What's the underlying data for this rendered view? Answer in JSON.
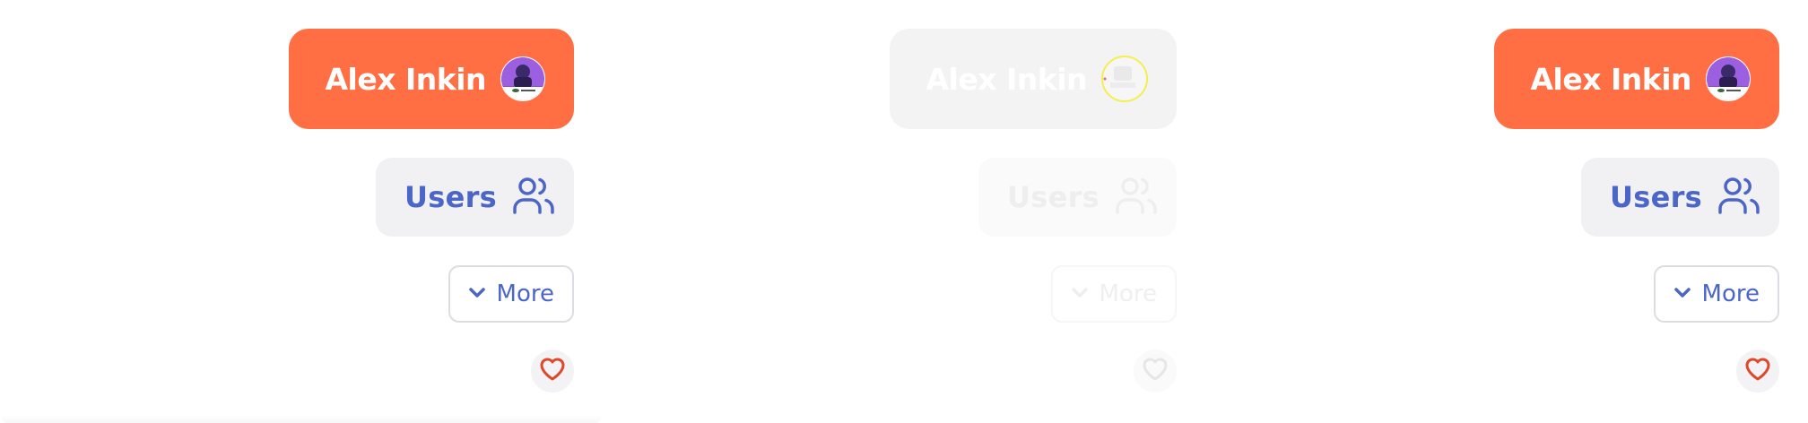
{
  "panels": [
    {
      "state": "normal",
      "user_button": {
        "name": "Alex Inkin",
        "avatar_icon": "avatar-icon"
      },
      "users_button": {
        "label": "Users",
        "icon": "users-icon"
      },
      "more_button": {
        "label": "More",
        "icon": "chevron-down-icon"
      },
      "favorite_button": {
        "icon": "heart-icon"
      }
    },
    {
      "state": "faded",
      "user_button": {
        "name": "Alex Inkin",
        "avatar_icon": "avatar-icon"
      },
      "users_button": {
        "label": "Users",
        "icon": "users-icon"
      },
      "more_button": {
        "label": "More",
        "icon": "chevron-down-icon"
      },
      "favorite_button": {
        "icon": "heart-icon"
      }
    },
    {
      "state": "normal",
      "user_button": {
        "name": "Alex Inkin",
        "avatar_icon": "avatar-icon"
      },
      "users_button": {
        "label": "Users",
        "icon": "users-icon"
      },
      "more_button": {
        "label": "More",
        "icon": "chevron-down-icon"
      },
      "favorite_button": {
        "icon": "heart-icon"
      }
    }
  ],
  "colors": {
    "accent_orange": "#ff6f43",
    "link_blue": "#4b66c7",
    "heart_red": "#e0482a",
    "button_gray": "#f1f1f4"
  }
}
